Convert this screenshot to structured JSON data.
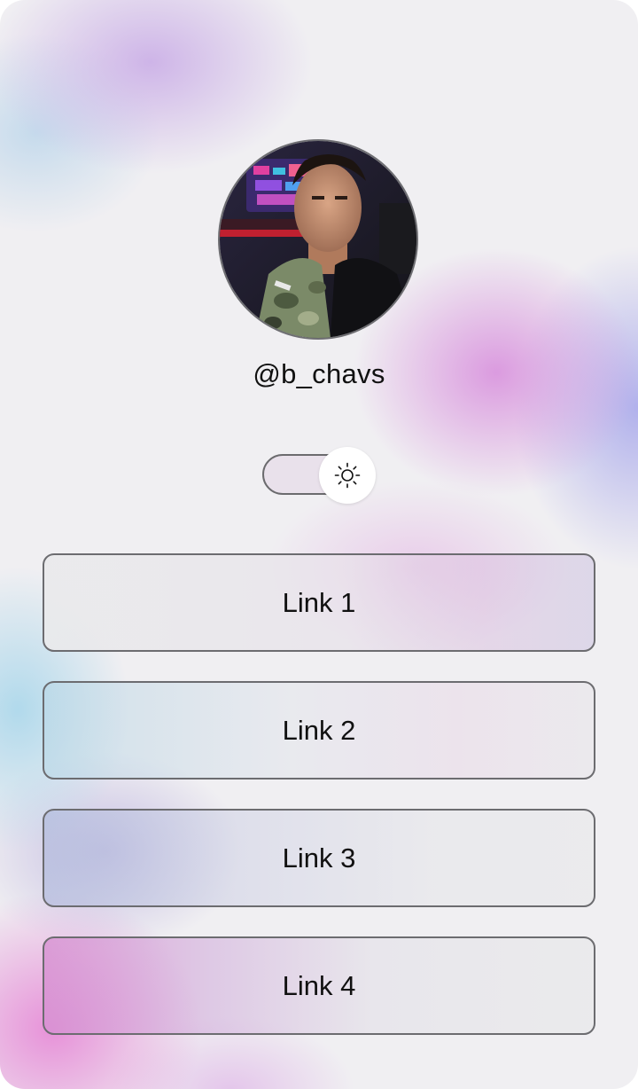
{
  "profile": {
    "handle": "@b_chavs",
    "avatar_alt": "profile-photo"
  },
  "theme_toggle": {
    "icon": "sun-icon",
    "state": "light"
  },
  "links": [
    {
      "label": "Link 1"
    },
    {
      "label": "Link 2"
    },
    {
      "label": "Link 3"
    },
    {
      "label": "Link 4"
    }
  ],
  "colors": {
    "border": "#6c6c70",
    "text": "#111111",
    "knob": "#ffffff"
  }
}
